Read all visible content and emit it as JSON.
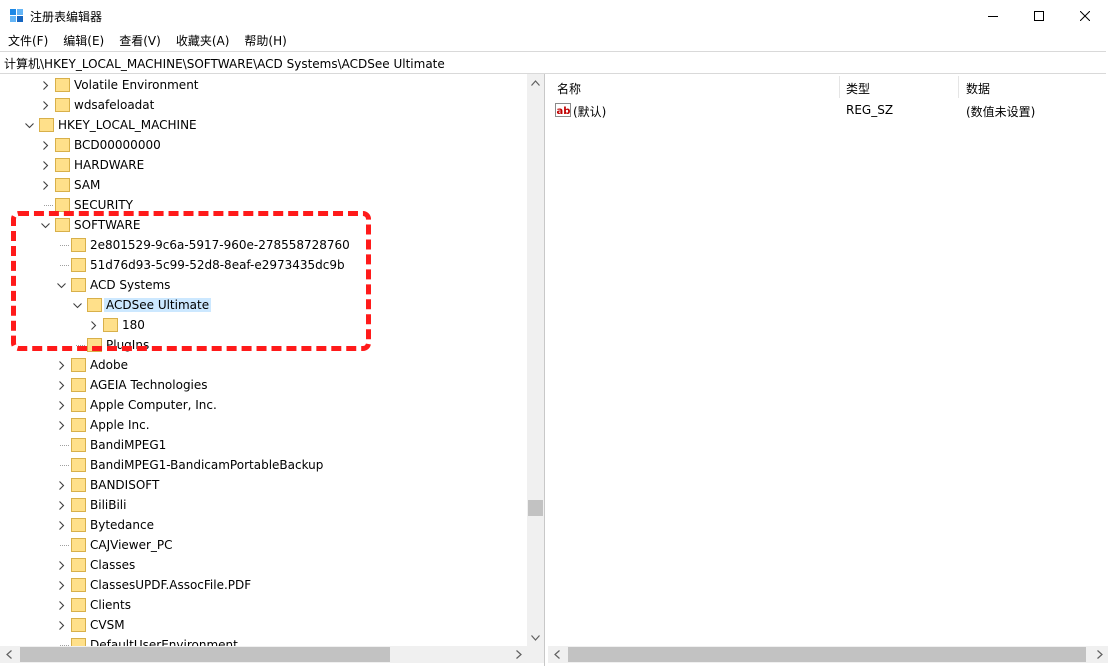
{
  "window": {
    "title": "注册表编辑器",
    "colors": {
      "accent": "#0078d7",
      "selection": "#cce8ff",
      "highlight": "#ff1a1a",
      "folder": "#ffe08a"
    }
  },
  "menu": [
    "文件(F)",
    "编辑(E)",
    "查看(V)",
    "收藏夹(A)",
    "帮助(H)"
  ],
  "address": "计算机\\HKEY_LOCAL_MACHINE\\SOFTWARE\\ACD Systems\\ACDSee Ultimate",
  "tree": [
    {
      "label": "Volatile Environment",
      "depth": 2,
      "expander": "collapsed"
    },
    {
      "label": "wdsafeloadat",
      "depth": 2,
      "expander": "collapsed"
    },
    {
      "label": "HKEY_LOCAL_MACHINE",
      "depth": 1,
      "expander": "expanded"
    },
    {
      "label": "BCD00000000",
      "depth": 2,
      "expander": "collapsed"
    },
    {
      "label": "HARDWARE",
      "depth": 2,
      "expander": "collapsed"
    },
    {
      "label": "SAM",
      "depth": 2,
      "expander": "collapsed"
    },
    {
      "label": "SECURITY",
      "depth": 2,
      "expander": "none"
    },
    {
      "label": "SOFTWARE",
      "depth": 2,
      "expander": "expanded"
    },
    {
      "label": "2e801529-9c6a-5917-960e-278558728760",
      "depth": 3,
      "expander": "none"
    },
    {
      "label": "51d76d93-5c99-52d8-8eaf-e2973435dc9b",
      "depth": 3,
      "expander": "none"
    },
    {
      "label": "ACD Systems",
      "depth": 3,
      "expander": "expanded"
    },
    {
      "label": "ACDSee Ultimate",
      "depth": 4,
      "expander": "expanded",
      "selected": true
    },
    {
      "label": "180",
      "depth": 5,
      "expander": "collapsed"
    },
    {
      "label": "PlugIns",
      "depth": 4,
      "expander": "none"
    },
    {
      "label": "Adobe",
      "depth": 3,
      "expander": "collapsed"
    },
    {
      "label": "AGEIA Technologies",
      "depth": 3,
      "expander": "collapsed"
    },
    {
      "label": "Apple Computer, Inc.",
      "depth": 3,
      "expander": "collapsed"
    },
    {
      "label": "Apple Inc.",
      "depth": 3,
      "expander": "collapsed"
    },
    {
      "label": "BandiMPEG1",
      "depth": 3,
      "expander": "none"
    },
    {
      "label": "BandiMPEG1-BandicamPortableBackup",
      "depth": 3,
      "expander": "none"
    },
    {
      "label": "BANDISOFT",
      "depth": 3,
      "expander": "collapsed"
    },
    {
      "label": "BiliBili",
      "depth": 3,
      "expander": "collapsed"
    },
    {
      "label": "Bytedance",
      "depth": 3,
      "expander": "collapsed"
    },
    {
      "label": "CAJViewer_PC",
      "depth": 3,
      "expander": "none"
    },
    {
      "label": "Classes",
      "depth": 3,
      "expander": "collapsed"
    },
    {
      "label": "ClassesUPDF.AssocFile.PDF",
      "depth": 3,
      "expander": "collapsed"
    },
    {
      "label": "Clients",
      "depth": 3,
      "expander": "collapsed"
    },
    {
      "label": "CVSM",
      "depth": 3,
      "expander": "collapsed"
    },
    {
      "label": "DefaultUserEnvironment",
      "depth": 3,
      "expander": "none"
    }
  ],
  "list": {
    "columns": [
      "名称",
      "类型",
      "数据"
    ],
    "rows": [
      {
        "name": "(默认)",
        "type": "REG_SZ",
        "data": "(数值未设置)",
        "icon": "reg-string-icon"
      }
    ]
  }
}
